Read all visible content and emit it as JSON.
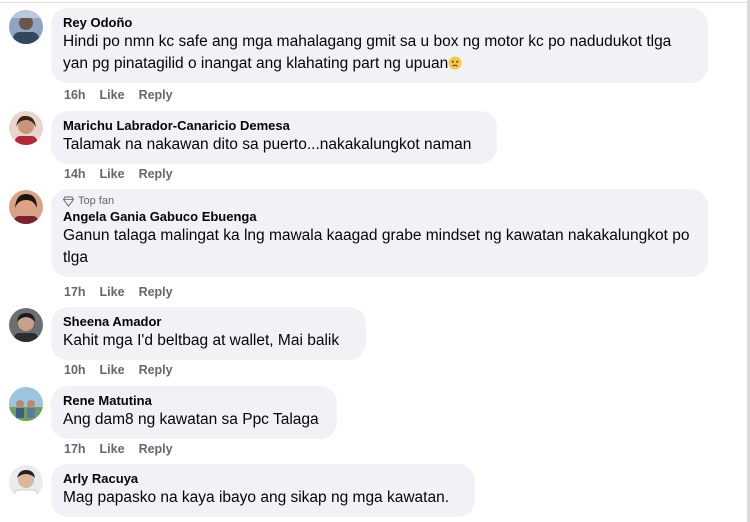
{
  "comments": [
    {
      "author": "Rey Odoño",
      "text": "Hindi po nmn kc safe ang mga mahalagang gmit sa u box ng motor kc po nadudukot tlga yan pg pinatagilid o inangat ang klahating part ng upuan",
      "time": "16h",
      "like": "Like",
      "reply": "Reply",
      "emoji": "sad-face-emoji"
    },
    {
      "author": "Marichu Labrador-Canaricio Demesa",
      "text": "Talamak na nakawan dito sa puerto...nakakalungkot naman",
      "time": "14h",
      "like": "Like",
      "reply": "Reply"
    },
    {
      "badge": "Top fan",
      "author": "Angela Gania Gabuco Ebuenga",
      "text": "Ganun talaga malingat ka lng mawala kaagad grabe mindset ng kawatan nakakalungkot po tlga",
      "time": "17h",
      "like": "Like",
      "reply": "Reply"
    },
    {
      "author": "Sheena Amador",
      "text": "Kahit mga I'd beltbag at wallet, Mai balik",
      "time": "10h",
      "like": "Like",
      "reply": "Reply"
    },
    {
      "author": "Rene Matutina",
      "text": "Ang dam8 ng kawatan sa Ppc Talaga",
      "time": "17h",
      "like": "Like",
      "reply": "Reply"
    },
    {
      "author": "Arly Racuya",
      "text": "Mag papasko na kaya ibayo ang sikap ng mga kawatan.",
      "time": "",
      "like": "",
      "reply": ""
    }
  ],
  "colors": {
    "bubble": "#f0f2f5",
    "text": "#050505",
    "secondary": "#65676b"
  }
}
